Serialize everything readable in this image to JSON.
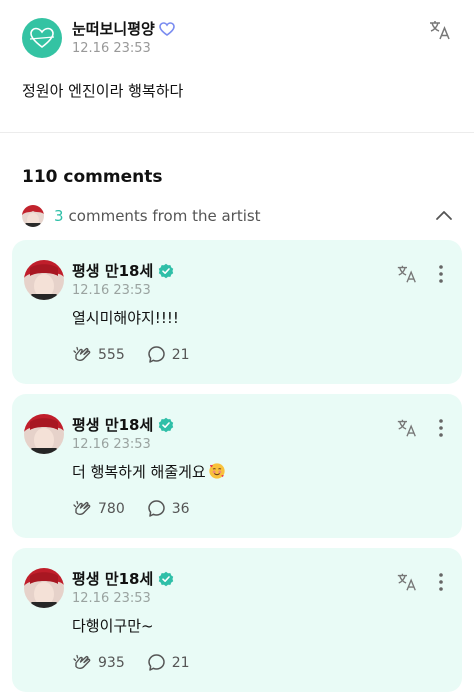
{
  "post": {
    "author": "눈떠보니평양",
    "time": "12.16 23:53",
    "body": "정원아 엔진이라 행복하다"
  },
  "comments_header": {
    "count_label": "110 comments"
  },
  "artist_comments": {
    "count": "3",
    "label": "comments from the artist"
  },
  "comments": [
    {
      "author": "평생 만18세",
      "time": "12.16 23:53",
      "text": "열시미해야지!!!!",
      "likes": "555",
      "replies": "21"
    },
    {
      "author": "평생 만18세",
      "time": "12.16 23:53",
      "text": "더 행복하게 해줄게요",
      "likes": "780",
      "replies": "36"
    },
    {
      "author": "평생 만18세",
      "time": "12.16 23:53",
      "text": "다행이구만~",
      "likes": "935",
      "replies": "21"
    }
  ],
  "colors": {
    "accent": "#2fbfa8",
    "card_bg": "#e9fbf6",
    "verified": "#2fbfa8"
  }
}
